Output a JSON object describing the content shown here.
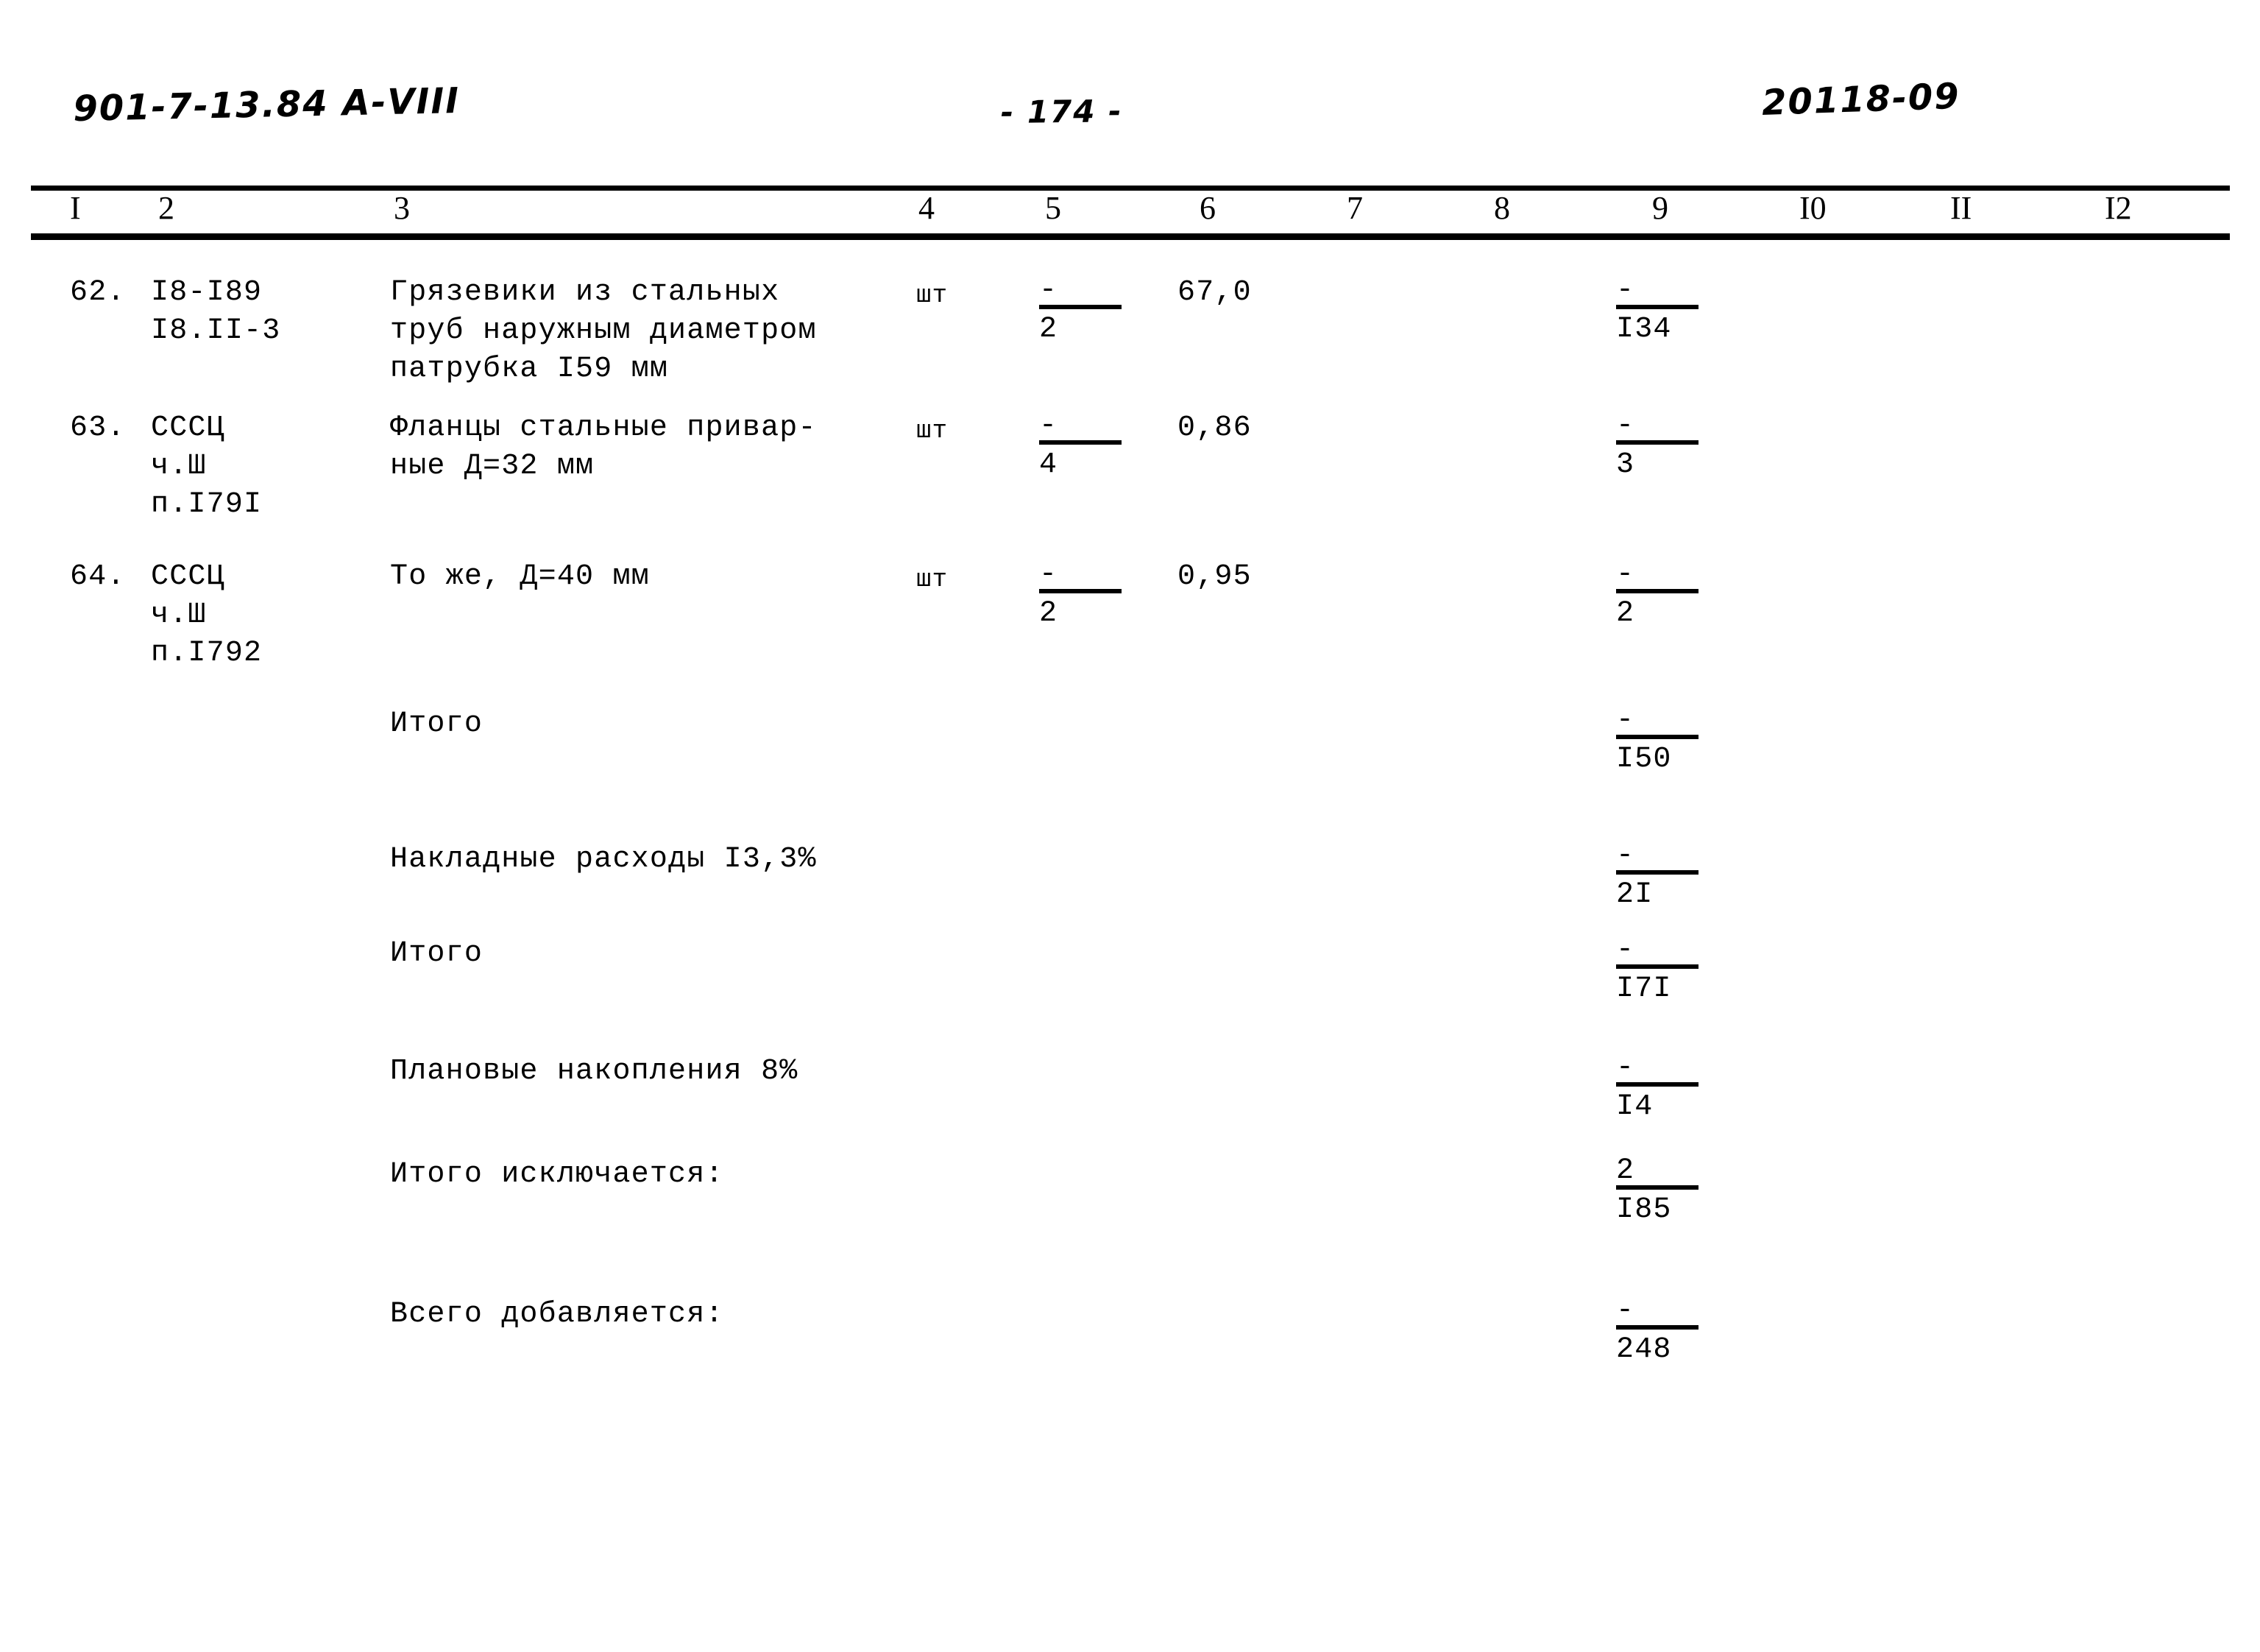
{
  "header": {
    "left_code": "901-7-13.84 А-VIII",
    "page_number": "- 174 -",
    "right_code": "20118-09"
  },
  "table": {
    "column_headers": [
      "I",
      "2",
      "3",
      "4",
      "5",
      "6",
      "7",
      "8",
      "9",
      "I0",
      "II",
      "I2"
    ],
    "rows": [
      {
        "num": "62.",
        "code_lines": [
          "I8-I89",
          "I8.II-3"
        ],
        "desc_lines": [
          "Грязевики из стальных",
          "труб наружным диаметром",
          "патрубка I59 мм"
        ],
        "unit": "шт",
        "qty_top": "-",
        "qty_bot": "2",
        "price": "67,0",
        "total_top": "-",
        "total_bot": "I34"
      },
      {
        "num": "63.",
        "code_lines": [
          "СССЦ",
          "ч.Ш",
          "п.I79I"
        ],
        "desc_lines": [
          "Фланцы стальные привар-",
          "ные Д=32 мм"
        ],
        "unit": "шт",
        "qty_top": "-",
        "qty_bot": "4",
        "price": "0,86",
        "total_top": "-",
        "total_bot": "3"
      },
      {
        "num": "64.",
        "code_lines": [
          "СССЦ",
          "ч.Ш",
          "п.I792"
        ],
        "desc_lines": [
          "То же, Д=40 мм"
        ],
        "unit": "шт",
        "qty_top": "-",
        "qty_bot": "2",
        "price": "0,95",
        "total_top": "-",
        "total_bot": "2"
      }
    ],
    "summary_rows": [
      {
        "label": "Итого",
        "total_top": "-",
        "total_bot": "I50"
      },
      {
        "label": "Накладные расходы I3,3%",
        "total_top": "-",
        "total_bot": "2I"
      },
      {
        "label": "Итого",
        "total_top": "-",
        "total_bot": "I7I"
      },
      {
        "label": "Плановые накопления 8%",
        "total_top": "-",
        "total_bot": "I4"
      },
      {
        "label": "Итого исключается:",
        "total_top": "2",
        "total_bot": "I85"
      },
      {
        "label": "Всего добавляется:",
        "total_top": "-",
        "total_bot": "248"
      }
    ]
  },
  "colors": {
    "ink": "#000000",
    "paper": "#ffffff"
  }
}
